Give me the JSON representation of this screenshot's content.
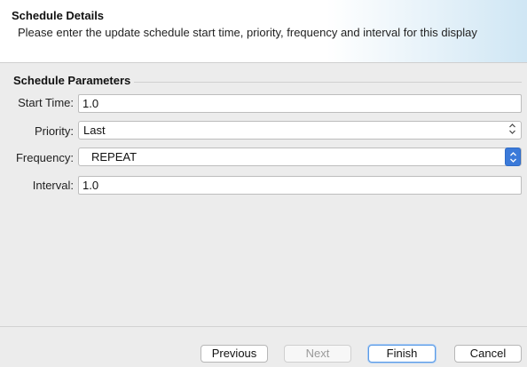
{
  "header": {
    "title": "Schedule Details",
    "description": "Please enter the update schedule start time, priority, frequency and interval for this display"
  },
  "group": {
    "title": "Schedule Parameters"
  },
  "fields": {
    "start_time": {
      "label": "Start Time:",
      "value": "1.0"
    },
    "priority": {
      "label": "Priority:",
      "value": "Last"
    },
    "frequency": {
      "label": "Frequency:",
      "value": "REPEAT"
    },
    "interval": {
      "label": "Interval:",
      "value": "1.0"
    }
  },
  "buttons": {
    "previous": "Previous",
    "next": "Next",
    "finish": "Finish",
    "cancel": "Cancel"
  },
  "icons": {
    "select_arrows": "up-down-chevron-icon",
    "combo_arrows": "up-down-chevron-icon"
  },
  "colors": {
    "accent": "#3b7ad9",
    "header_gradient_end": "#cfe6f4"
  }
}
